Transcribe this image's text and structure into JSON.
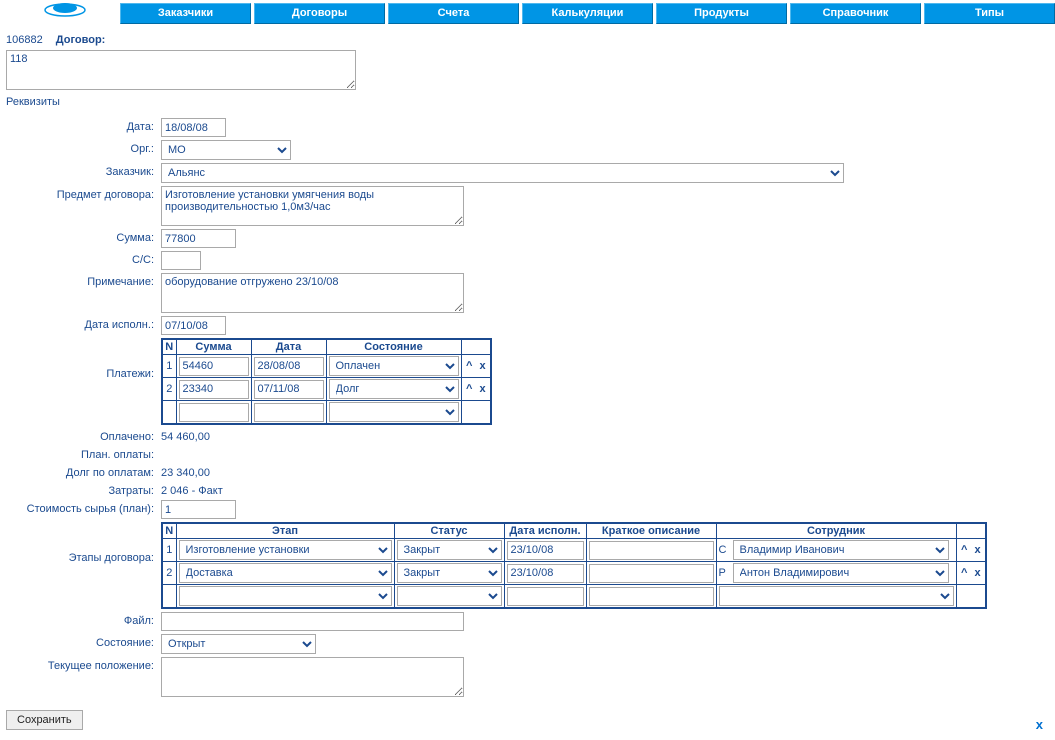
{
  "nav": [
    "Заказчики",
    "Договоры",
    "Счета",
    "Калькуляции",
    "Продукты",
    "Справочник",
    "Типы"
  ],
  "doc": {
    "id": "106882",
    "title_label": "Договор:",
    "title_value": "118",
    "requisites_link": "Реквизиты"
  },
  "labels": {
    "date": "Дата:",
    "org": "Орг.:",
    "customer": "Заказчик:",
    "subject": "Предмет договора:",
    "sum": "Сумма:",
    "cc": "С/С:",
    "note": "Примечание:",
    "exec_date": "Дата исполн.:",
    "payments": "Платежи:",
    "paid": "Оплачено:",
    "plan_pay": "План. оплаты:",
    "debt": "Долг по оплатам:",
    "costs": "Затраты:",
    "raw_plan": "Стоимость сырья (план):",
    "stages": "Этапы договора:",
    "file": "Файл:",
    "state": "Состояние:",
    "position": "Текущее положение:"
  },
  "values": {
    "date": "18/08/08",
    "org": "МО",
    "customer": "Альянс",
    "subject": "Изготовление установки умягчения воды производительностью 1,0м3/час",
    "sum": "77800",
    "cc": "",
    "note": "оборудование отгружено 23/10/08",
    "exec_date": "07/10/08",
    "paid": "54 460,00",
    "plan_pay": "",
    "debt": "23 340,00",
    "costs": "2 046 - Факт",
    "raw_plan": "1",
    "file": "",
    "state": "Открыт",
    "position": ""
  },
  "payments": {
    "headers": {
      "n": "N",
      "sum": "Сумма",
      "date": "Дата",
      "state": "Состояние"
    },
    "rows": [
      {
        "n": "1",
        "sum": "54460",
        "date": "28/08/08",
        "state": "Оплачен"
      },
      {
        "n": "2",
        "sum": "23340",
        "date": "07/11/08",
        "state": "Долг"
      }
    ],
    "blank": {
      "sum": "",
      "date": "",
      "state": ""
    }
  },
  "stages": {
    "headers": {
      "n": "N",
      "stage": "Этап",
      "status": "Статус",
      "exec": "Дата исполн.",
      "desc": "Краткое описание",
      "emp": "Сотрудник"
    },
    "rows": [
      {
        "n": "1",
        "stage": "Изготовление установки",
        "status": "Закрыт",
        "exec": "23/10/08",
        "desc": "",
        "emp_pref": "С",
        "emp": "Владимир Иванович"
      },
      {
        "n": "2",
        "stage": "Доставка",
        "status": "Закрыт",
        "exec": "23/10/08",
        "desc": "",
        "emp_pref": "Р",
        "emp": "Антон Владимирович"
      }
    ],
    "blank": {
      "stage": "",
      "status": "",
      "exec": "",
      "desc": "",
      "emp": ""
    }
  },
  "actions": {
    "save": "Сохранить",
    "up": "^",
    "del": "x",
    "close_page": "x"
  }
}
